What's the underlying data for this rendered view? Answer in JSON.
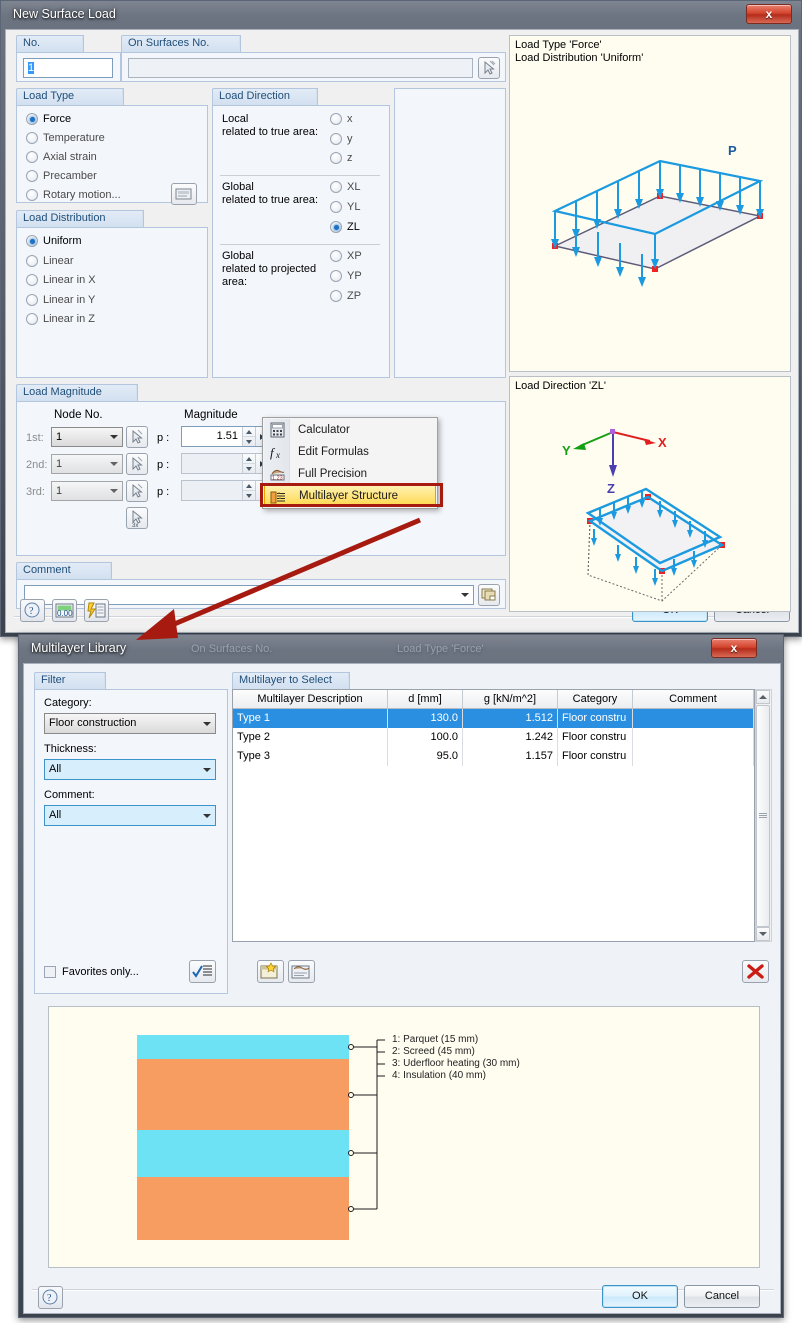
{
  "dialog1": {
    "title": "New Surface Load",
    "ghost_title": "",
    "close_label": "x",
    "no_group": {
      "label": "No.",
      "value": "1"
    },
    "surfaces_group": {
      "label": "On Surfaces No.",
      "value": "",
      "pick_icon": "pick-surface-icon"
    },
    "load_type": {
      "label": "Load Type",
      "options": [
        {
          "label": "Force",
          "selected": true
        },
        {
          "label": "Temperature",
          "selected": false
        },
        {
          "label": "Axial strain",
          "selected": false
        },
        {
          "label": "Precamber",
          "selected": false
        },
        {
          "label": "Rotary motion...",
          "selected": false
        }
      ],
      "settings_icon": "rotary-settings-icon"
    },
    "load_distribution": {
      "label": "Load Distribution",
      "options": [
        {
          "label": "Uniform",
          "selected": true
        },
        {
          "label": "Linear",
          "selected": false
        },
        {
          "label": "Linear in X",
          "selected": false
        },
        {
          "label": "Linear in Y",
          "selected": false
        },
        {
          "label": "Linear in Z",
          "selected": false
        }
      ]
    },
    "load_direction": {
      "label": "Load Direction",
      "sections": [
        {
          "caption": "Local\nrelated to true area:",
          "options": [
            {
              "label": "x",
              "selected": false
            },
            {
              "label": "y",
              "selected": false
            },
            {
              "label": "z",
              "selected": false
            }
          ]
        },
        {
          "caption": "Global\nrelated to true area:",
          "options": [
            {
              "label": "XL",
              "selected": false
            },
            {
              "label": "YL",
              "selected": false
            },
            {
              "label": "ZL",
              "selected": true
            }
          ]
        },
        {
          "caption": "Global\nrelated to projected\narea:",
          "options": [
            {
              "label": "XP",
              "selected": false
            },
            {
              "label": "YP",
              "selected": false
            },
            {
              "label": "ZP",
              "selected": false
            }
          ]
        }
      ]
    },
    "load_magnitude": {
      "label": "Load Magnitude",
      "col_node": "Node No.",
      "col_magnitude": "Magnitude",
      "rows": [
        {
          "ordinal": "1st:",
          "node": "1",
          "p_label": "p :",
          "value": "1.51",
          "enabled": true
        },
        {
          "ordinal": "2nd:",
          "node": "1",
          "p_label": "p :",
          "value": "",
          "enabled": false
        },
        {
          "ordinal": "3rd:",
          "node": "1",
          "p_label": "p :",
          "value": "",
          "enabled": false
        }
      ],
      "pick_icon": "pick-node-icon",
      "pick3_icon": "pick-3-nodes-icon"
    },
    "comment": {
      "label": "Comment",
      "value": "",
      "library_icon": "comment-library-icon"
    },
    "footer_icons": [
      "help-icon",
      "units-icon",
      "settings-lightning-icon"
    ],
    "ok_label": "OK",
    "cancel_label": "Cancel",
    "preview_top": {
      "caption": "Load Type 'Force'\nLoad Distribution 'Uniform'",
      "load_label": "P"
    },
    "preview_bottom": {
      "caption": "Load Direction 'ZL'",
      "axis_x": "X",
      "axis_y": "Y",
      "axis_z": "Z"
    }
  },
  "context_menu": {
    "items": [
      {
        "label": "Calculator",
        "icon": "calculator-icon",
        "highlighted": false
      },
      {
        "label": "Edit Formulas",
        "icon": "fx-icon",
        "highlighted": false
      },
      {
        "label": "Full Precision",
        "icon": "full-precision-icon",
        "highlighted": false
      },
      {
        "label": "Multilayer Structure",
        "icon": "multilayer-icon",
        "highlighted": true
      }
    ]
  },
  "dialog2": {
    "title": "Multilayer Library",
    "ghost_title_1": "On Surfaces No.",
    "ghost_title_2": "Load Type 'Force'",
    "close_label": "x",
    "filter": {
      "label": "Filter",
      "category_label": "Category:",
      "category_value": "Floor construction",
      "thickness_label": "Thickness:",
      "thickness_value": "All",
      "comment_label": "Comment:",
      "comment_value": "All",
      "favorites_label": "Favorites only...",
      "favorites_checked": false,
      "favorites_icon": "favorites-list-icon"
    },
    "list": {
      "label": "Multilayer to Select",
      "columns": [
        "Multilayer Description",
        "d [mm]",
        "g [kN/m^2]",
        "Category",
        "Comment"
      ],
      "rows": [
        {
          "desc": "Type 1",
          "d": "130.0",
          "g": "1.512",
          "category": "Floor constru",
          "comment": "",
          "selected": true
        },
        {
          "desc": "Type 2",
          "d": "100.0",
          "g": "1.242",
          "category": "Floor constru",
          "comment": "",
          "selected": false
        },
        {
          "desc": "Type 3",
          "d": "95.0",
          "g": "1.157",
          "category": "Floor constru",
          "comment": "",
          "selected": false
        }
      ],
      "new_icon": "new-multilayer-icon",
      "edit_icon": "edit-multilayer-icon",
      "delete_icon": "delete-red-x-icon"
    },
    "diagram": {
      "legend": [
        "1: Parquet (15 mm)",
        "2: Screed (45 mm)",
        "3: Uderfloor heating (30 mm)",
        "4: Insulation (40 mm)"
      ],
      "layers": [
        {
          "name": "Parquet",
          "thickness_mm": 15,
          "color": "#6ee2f5"
        },
        {
          "name": "Screed",
          "thickness_mm": 45,
          "color": "#f79d62"
        },
        {
          "name": "Uderfloor heating",
          "thickness_mm": 30,
          "color": "#6ee2f5"
        },
        {
          "name": "Insulation",
          "thickness_mm": 40,
          "color": "#f79d62"
        }
      ]
    },
    "help_icon": "help-icon",
    "ok_label": "OK",
    "cancel_label": "Cancel"
  },
  "colors": {
    "accent_blue": "#2a8fe0",
    "highlight_yellow": "#ffd84d",
    "callout_red": "#a61a10",
    "layer_cyan": "#6ee2f5",
    "layer_orange": "#f79d62",
    "preview_bg": "#fffdf0"
  }
}
